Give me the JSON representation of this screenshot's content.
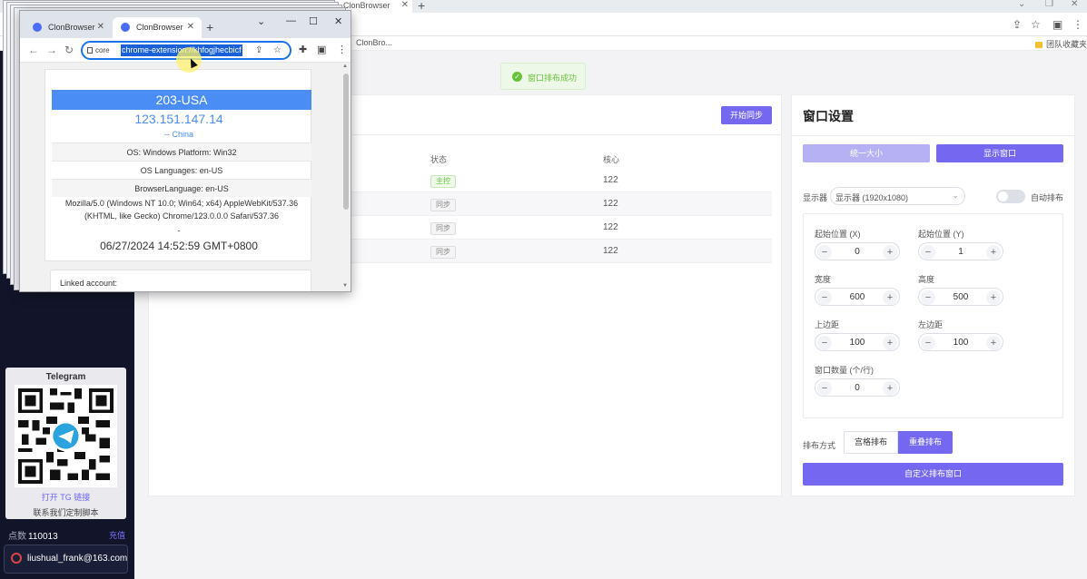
{
  "background_browser": {
    "tab_title": "ClonBrowser",
    "bookmark_item": "ClonBro...",
    "bookmark_folder": "团队收藏夹"
  },
  "sidebar": {
    "telegram": {
      "title": "Telegram",
      "link_text": "打开 TG 链接",
      "subtitle": "联系我们定制脚本"
    },
    "points": {
      "label": "点数",
      "value": "110013"
    },
    "recharge_label": "充值",
    "user_email": "liushual_frank@163.com"
  },
  "toast": {
    "text": "窗口排布成功"
  },
  "sync_panel": {
    "start_sync_button": "开始同步",
    "columns": {
      "status": "状态",
      "core": "核心"
    },
    "rows": [
      {
        "status": "主控",
        "core": "122"
      },
      {
        "status": "同步",
        "core": "122"
      },
      {
        "status": "同步",
        "core": "122"
      },
      {
        "status": "同步",
        "core": "122"
      }
    ]
  },
  "window_settings": {
    "title": "窗口设置",
    "unify_size_button": "统一大小",
    "show_window_button": "显示窗口",
    "display_label": "显示器",
    "display_value": "显示器 (1920x1080)",
    "auto_arrange_label": "自动排布",
    "fields": {
      "start_x": {
        "label": "起始位置 (X)",
        "value": "0"
      },
      "start_y": {
        "label": "起始位置 (Y)",
        "value": "1"
      },
      "width": {
        "label": "宽度",
        "value": "600"
      },
      "height": {
        "label": "高度",
        "value": "500"
      },
      "top_margin": {
        "label": "上边距",
        "value": "100"
      },
      "left_margin": {
        "label": "左边距",
        "value": "100"
      },
      "window_count": {
        "label": "窗口数量 (个/行)",
        "value": "0"
      }
    },
    "arrange_label": "排布方式",
    "arrange_grid": "宫格排布",
    "arrange_overlap": "重叠排布",
    "custom_button": "自定义排布窗口"
  },
  "popup_browser": {
    "tabs": [
      "ClonBrowser",
      "ClonBrowser"
    ],
    "omnibox_scheme": "core",
    "omnibox_url": "chrome-extension://khfogjhecbicf",
    "card": {
      "header": "203-USA",
      "ip": "123.151.147.14",
      "country": "-- China",
      "os": "OS: Windows Platform: Win32",
      "os_languages": "OS Languages: en-US",
      "browser_language": "BrowserLanguage: en-US",
      "user_agent_line1": "Mozilla/5.0 (Windows NT 10.0; Win64; x64) AppleWebKit/537.36",
      "user_agent_line2": "(KHTML, like Gecko) Chrome/123.0.0.0 Safari/537.36",
      "separator": "-",
      "timestamp": "06/27/2024 14:52:59 GMT+0800"
    },
    "linked_account_label": "Linked account:"
  }
}
